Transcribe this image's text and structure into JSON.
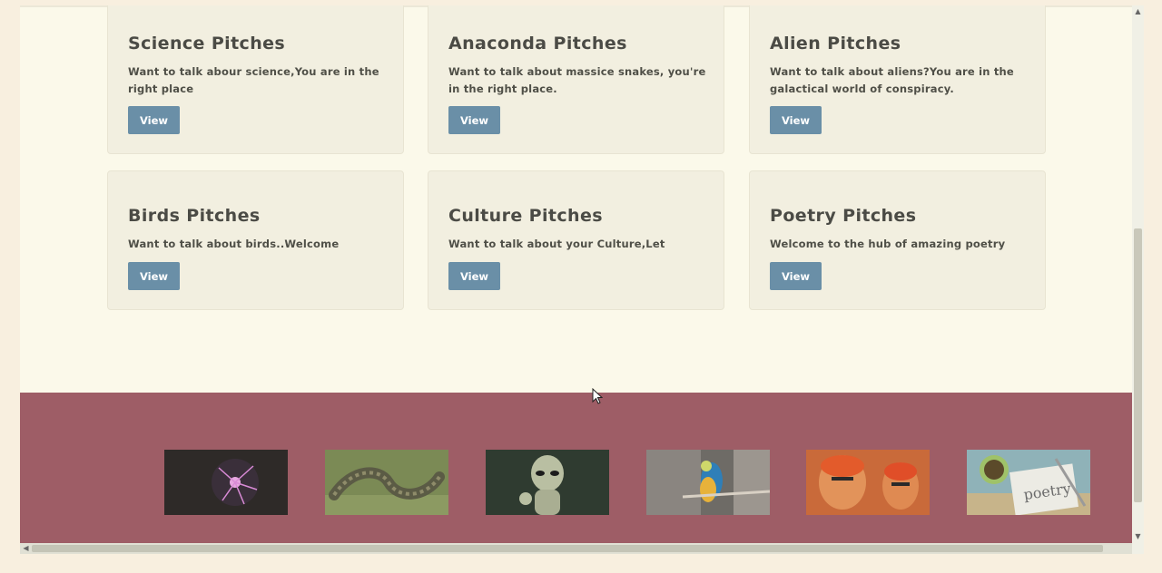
{
  "cards": [
    {
      "title": "Science Pitches",
      "desc": "Want to talk abour science,You are in the right place",
      "button": "View"
    },
    {
      "title": "Anaconda Pitches",
      "desc": "Want to talk about massice snakes, you're in the right place.",
      "button": "View"
    },
    {
      "title": "Alien Pitches",
      "desc": "Want to talk about aliens?You are in the galactical world of conspiracy.",
      "button": "View"
    },
    {
      "title": "Birds Pitches",
      "desc": "Want to talk about birds..Welcome",
      "button": "View"
    },
    {
      "title": "Culture Pitches",
      "desc": "Want to talk about your Culture,Let",
      "button": "View"
    },
    {
      "title": "Poetry Pitches",
      "desc": "Welcome to the hub of amazing poetry",
      "button": "View"
    }
  ],
  "footer": {
    "images": [
      {
        "name": "plasma-ball-image"
      },
      {
        "name": "anaconda-image"
      },
      {
        "name": "alien-image"
      },
      {
        "name": "parrot-image"
      },
      {
        "name": "culture-image"
      },
      {
        "name": "poetry-image"
      }
    ]
  },
  "colors": {
    "page_bg": "#fbf9ea",
    "card_bg": "#f2efe0",
    "button": "#6a8fa7",
    "footer": "#9e5d66"
  }
}
